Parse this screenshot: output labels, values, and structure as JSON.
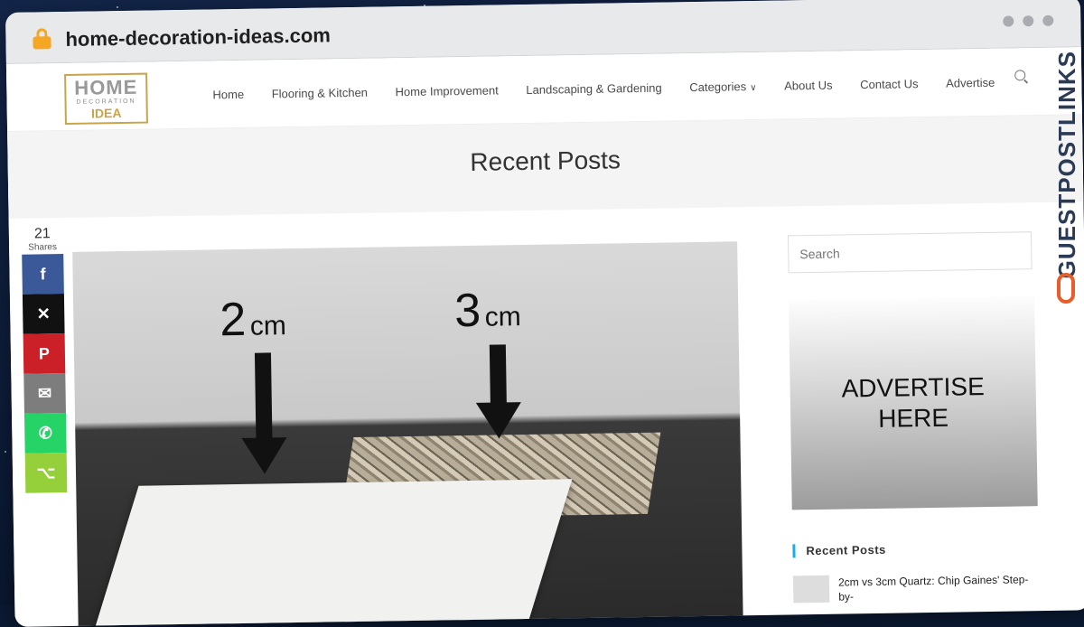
{
  "browser": {
    "url": "home-decoration-ideas.com"
  },
  "logo": {
    "line1": "HOME",
    "line2": "DECORATION",
    "line3": "IDEA"
  },
  "nav": {
    "items": [
      {
        "label": "Home"
      },
      {
        "label": "Flooring & Kitchen"
      },
      {
        "label": "Home Improvement"
      },
      {
        "label": "Landscaping & Gardening"
      },
      {
        "label": "Categories"
      },
      {
        "label": "About Us"
      },
      {
        "label": "Contact Us"
      },
      {
        "label": "Advertise"
      }
    ]
  },
  "page": {
    "title": "Recent Posts"
  },
  "featured_image": {
    "label_left_num": "2",
    "label_left_unit": "cm",
    "label_right_num": "3",
    "label_right_unit": "cm"
  },
  "share": {
    "count": "21",
    "label": "Shares"
  },
  "sidebar": {
    "search_placeholder": "Search",
    "ad_line1": "ADVERTISE",
    "ad_line2": "HERE",
    "recent_title": "Recent Posts",
    "recent_post_title": "2cm vs 3cm Quartz: Chip Gaines' Step-by-"
  },
  "watermark": {
    "text": "GUESTPOSTLINKS"
  }
}
